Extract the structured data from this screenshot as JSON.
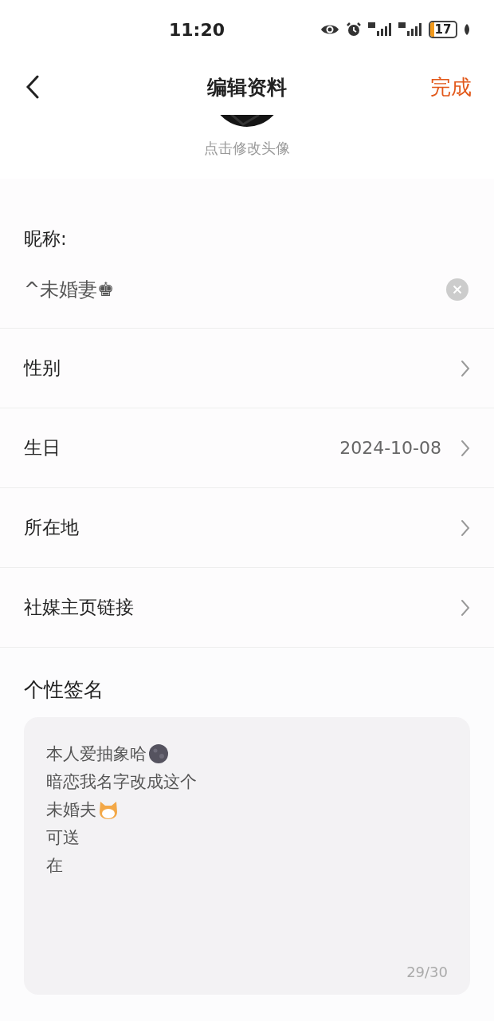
{
  "status_bar": {
    "time": "11:20",
    "battery": "17"
  },
  "header": {
    "title": "编辑资料",
    "done": "完成"
  },
  "avatar": {
    "hint": "点击修改头像"
  },
  "nickname": {
    "label": "昵称:",
    "value": "^未婚妻♚"
  },
  "rows": [
    {
      "label": "性别"
    },
    {
      "label": "生日",
      "value": "2024-10-08"
    },
    {
      "label": "所在地"
    },
    {
      "label": "社媒主页链接"
    }
  ],
  "signature": {
    "title": "个性签名",
    "lines": [
      {
        "text": "本人爱抽象哈",
        "kind": "moon"
      },
      {
        "text": "暗恋我名字改成这个",
        "kind": "plain"
      },
      {
        "text": "未婚夫",
        "kind": "cat"
      },
      {
        "text": "可送",
        "kind": "plain"
      },
      {
        "text": "在",
        "kind": "plain"
      }
    ],
    "counter": "29/30"
  }
}
